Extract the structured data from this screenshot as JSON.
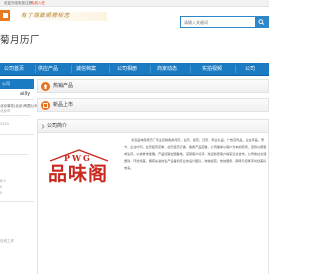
{
  "topbar": {
    "link_a": "欢迎光临",
    "link_b": "免费注册",
    "link_c": "免费入驻"
  },
  "header": {
    "logo_icon": "site-logo-icon",
    "slogan": "有了瑞致顺牌标志",
    "search_placeholder": "请输入关键词",
    "shop_title": "菊月历厂"
  },
  "nav": {
    "items": [
      "公司首页",
      "供应产品",
      "诚信档案",
      "公司相册",
      "商家动态",
      "实拍视频",
      "公司"
    ]
  },
  "sidebar": {
    "header_label": "公司",
    "lines": [
      "ailly",
      "北京菊花(北京)有限公司",
      "北京市",
      "2019",
      "8.0",
      "0",
      "0"
    ],
    "strong_text": "ailly",
    "footer": "在线工作"
  },
  "panels": {
    "hot_products": "热销产品",
    "new_products": "新品上市",
    "company_intro": "公司简介"
  },
  "company": {
    "logo_latin": "PWG",
    "logo_cn": "品味阁",
    "intro_text": "北京品味阁月历厂专业定制各类月历，台历，挂历，日历，商业礼品，广告宣传品，企业年画，贺卡，企业内刊，台历挂历定制，台历挂历订做，各类产品定做，公司秉承以客户为本的原则，坚持以质量求生存，以信誉求发展。产品远销全国各地，深受客户好评，欢迎新老客户前来洽谈合作。公司地址交通便利，环境优美，拥有先进的生产设备和专业的设计团队，诚信经营，热忱服务，期待与您携手共创美好未来。"
  }
}
